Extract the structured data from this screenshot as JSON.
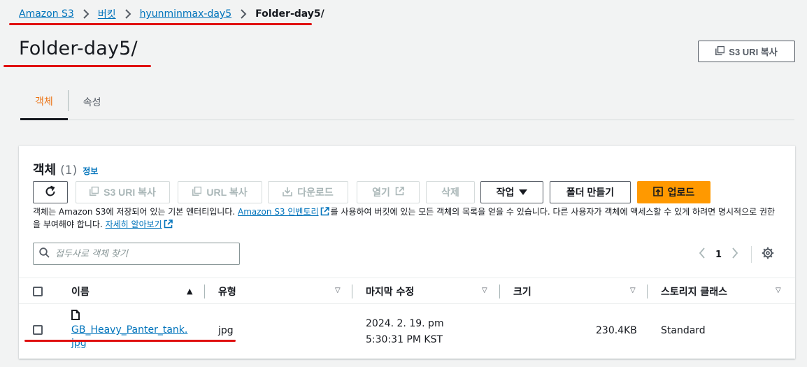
{
  "breadcrumb": {
    "items": [
      "Amazon S3",
      "버킷",
      "hyunminmax-day5"
    ],
    "current": "Folder-day5/"
  },
  "page": {
    "title": "Folder-day5/",
    "copy_uri_label": "S3 URI 복사"
  },
  "tabs": [
    {
      "label": "객체",
      "active": true
    },
    {
      "label": "속성",
      "active": false
    }
  ],
  "panel": {
    "title": "객체",
    "count": "(1)",
    "info": "정보",
    "toolbar": {
      "copy_s3_uri": "S3 URI 복사",
      "copy_url": "URL 복사",
      "download": "다운로드",
      "open": "열기",
      "delete": "삭제",
      "actions": "작업",
      "create_folder": "폴더 만들기",
      "upload": "업로드"
    },
    "description": {
      "part1": "객체는 Amazon S3에 저장되어 있는 기본 엔터티입니다. ",
      "inventory_link": "Amazon S3 인벤토리",
      "part2": "를 사용하여 버킷에 있는 모든 객체의 목록을 얻을 수 있습니다. 다른 사용자가 객체에 액세스할 수 있게 하려면 명시적으로 권한을 부여해야 합니다. ",
      "learn_more": "자세히 알아보기"
    },
    "search_placeholder": "접두사로 객체 찾기",
    "page_number": "1"
  },
  "table": {
    "columns": [
      "이름",
      "유형",
      "마지막 수정",
      "크기",
      "스토리지 클래스"
    ],
    "rows": [
      {
        "name": "GB_Heavy_Panter_tank.jpg",
        "type": "jpg",
        "last_modified": "2024. 2. 19. pm 5:30:31 PM KST",
        "size": "230.4KB",
        "storage_class": "Standard"
      }
    ]
  },
  "colors": {
    "link": "#0073bb",
    "primary": "#ff9900",
    "active_tab": "#ec7211",
    "annotation": "#e01010"
  }
}
